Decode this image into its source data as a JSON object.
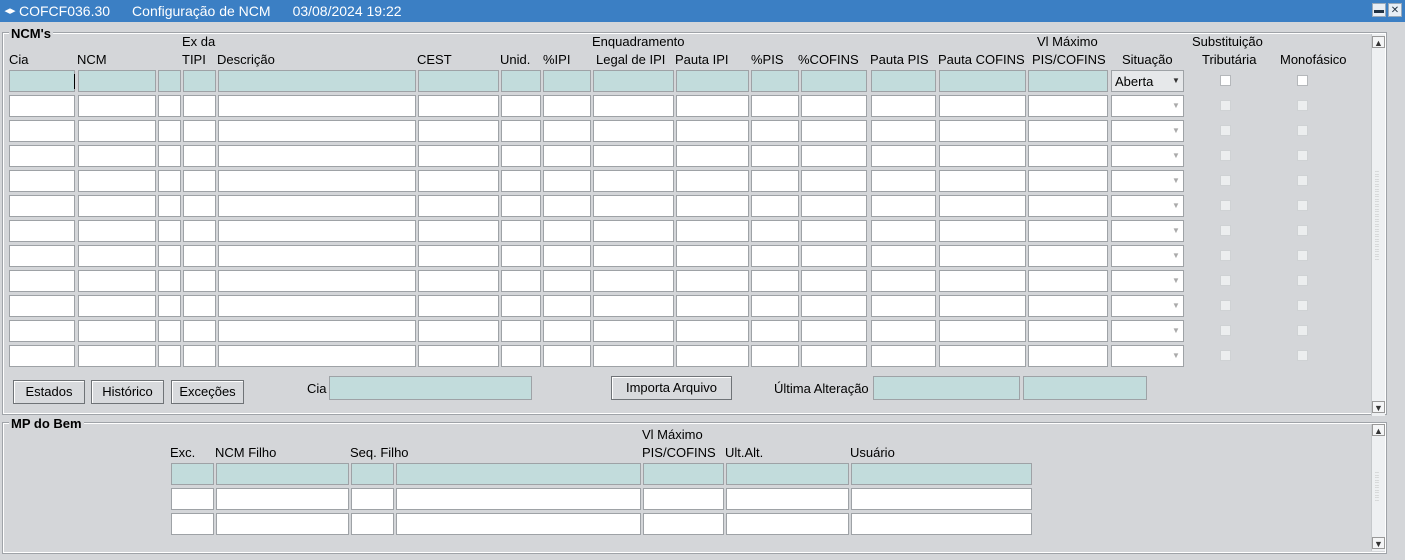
{
  "window": {
    "form_id": "COFCF036.30",
    "title": "Configuração de NCM",
    "datetime": "03/08/2024 19:22",
    "window_icon": "form-icon",
    "minimize_icon": "minimize-icon",
    "close_icon": "close-icon"
  },
  "ncm_block": {
    "title": "NCM's",
    "headers": {
      "cia": "Cia",
      "ncm": "NCM",
      "ex_da": "Ex da",
      "tipi": "TIPI",
      "descricao": "Descrição",
      "cest": "CEST",
      "unid": "Unid.",
      "pct_ipi": "%IPI",
      "enquadramento": "Enquadramento",
      "legal_de_ipi": "Legal de IPI",
      "pauta_ipi": "Pauta IPI",
      "pct_pis": "%PIS",
      "pct_cofins": "%COFINS",
      "pauta_pis": "Pauta PIS",
      "pauta_cofins": "Pauta COFINS",
      "vl_maximo": "Vl Máximo",
      "pis_cofins": "PIS/COFINS",
      "situacao": "Situação",
      "substituicao": "Substituição",
      "tributaria": "Tributária",
      "monofasico": "Monofásico"
    },
    "first_row_situacao": "Aberta",
    "buttons": {
      "estados": "Estados",
      "historico": "Histórico",
      "excecoes": "Exceções",
      "importa_arquivo": "Importa Arquivo"
    },
    "footer": {
      "cia_label": "Cia",
      "ultima_alteracao_label": "Última Alteração"
    }
  },
  "mp_block": {
    "title": "MP do Bem",
    "headers": {
      "exc": "Exc.",
      "ncm_filho": "NCM Filho",
      "seq_filho": "Seq. Filho",
      "vl_maximo": "Vl Máximo",
      "pis_cofins": "PIS/COFINS",
      "ult_alt": "Ult.Alt.",
      "usuario": "Usuário"
    }
  },
  "colors": {
    "titlebar": "#3b7fc4",
    "current_row": "#c2dcdc",
    "background": "#d4d6d9"
  }
}
